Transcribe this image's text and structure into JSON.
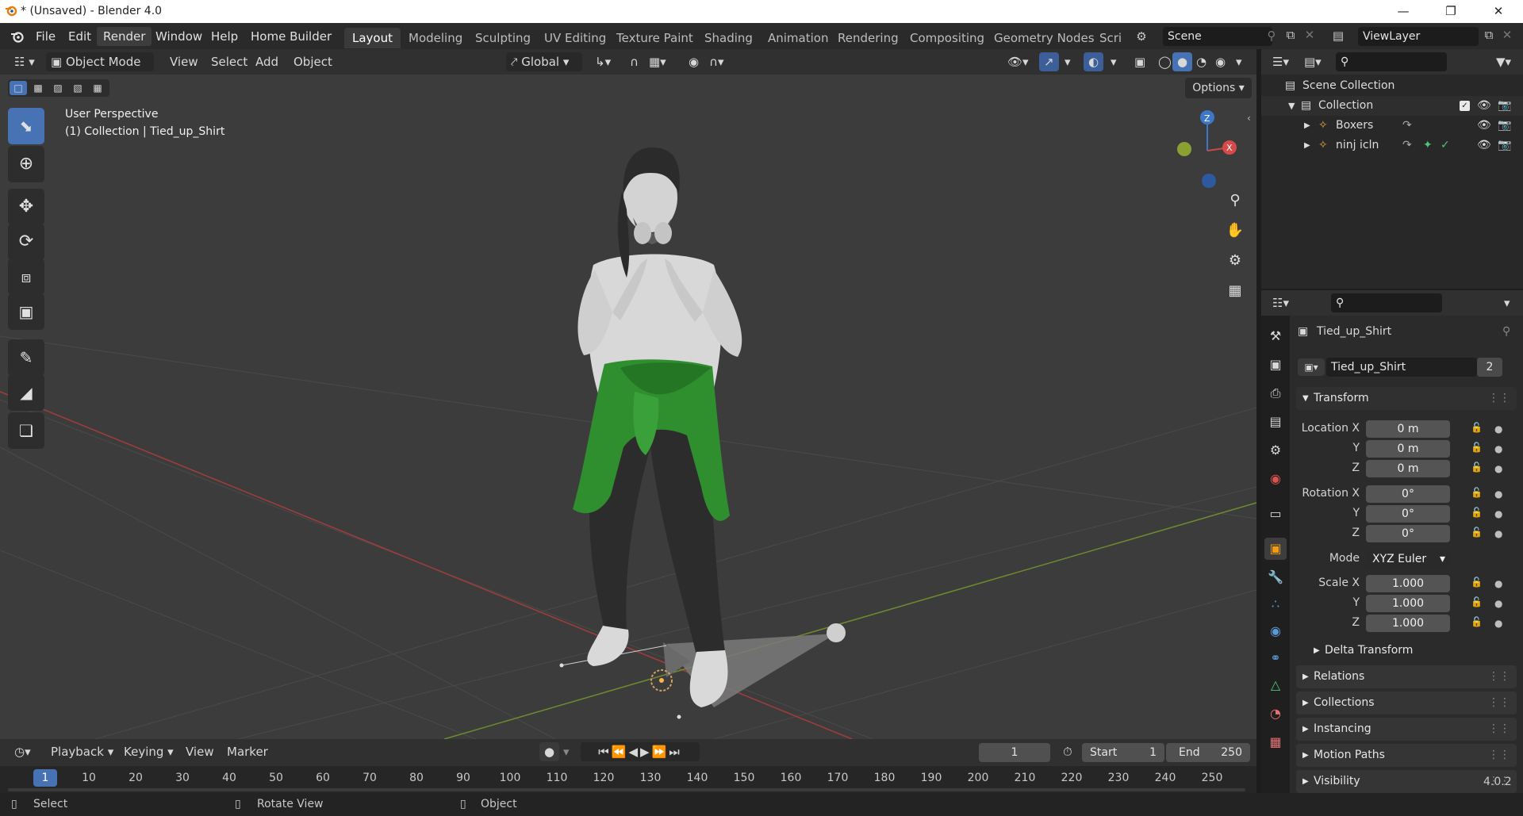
{
  "window": {
    "title": "* (Unsaved) - Blender 4.0",
    "controls": [
      "minimize-icon",
      "restore-icon",
      "close-icon"
    ]
  },
  "menubar": {
    "items": [
      "File",
      "Edit",
      "Render",
      "Window",
      "Help",
      "Home Builder"
    ],
    "active_item": "Render"
  },
  "workspaces": {
    "tabs": [
      "Layout",
      "Modeling",
      "Sculpting",
      "UV Editing",
      "Texture Paint",
      "Shading",
      "Animation",
      "Rendering",
      "Compositing",
      "Geometry Nodes",
      "Scri"
    ],
    "active": "Layout"
  },
  "scene_selector": {
    "value": "Scene"
  },
  "viewlayer_selector": {
    "value": "ViewLayer"
  },
  "viewport_header": {
    "mode": "Object Mode",
    "menus": [
      "View",
      "Select",
      "Add",
      "Object"
    ],
    "orientation": "Global",
    "options_label": "Options"
  },
  "viewport": {
    "perspective_label": "User Perspective",
    "context_label": "(1) Collection | Tied_up_Shirt",
    "gizmo_axes": {
      "z": "Z",
      "x": "X"
    },
    "colors": {
      "background": "#3c3c3c",
      "shirt": "#2f8f2f",
      "pants": "#2c2c2c",
      "skin": "#d8d8d8",
      "x_axis": "#a33c3c",
      "y_axis": "#6e8a2e"
    }
  },
  "toolbar": {
    "tools": [
      "select-box-icon",
      "cursor-icon",
      "move-icon",
      "rotate-icon",
      "scale-icon",
      "transform-icon",
      "annotate-icon",
      "measure-icon",
      "add-cube-icon"
    ]
  },
  "outliner": {
    "root": "Scene Collection",
    "collection": "Collection",
    "items": [
      {
        "name": "Boxers"
      },
      {
        "name": "ninj icln"
      }
    ]
  },
  "properties": {
    "object_name": "Tied_up_Shirt",
    "data_name": "Tied_up_Shirt",
    "users_count": "2",
    "transform_label": "Transform",
    "location": {
      "label": "Location X",
      "x": "0 m",
      "y": "0 m",
      "z": "0 m"
    },
    "rotation": {
      "label": "Rotation X",
      "x": "0°",
      "y": "0°",
      "z": "0°"
    },
    "mode": {
      "label": "Mode",
      "value": "XYZ Euler"
    },
    "scale": {
      "label": "Scale X",
      "x": "1.000",
      "y": "1.000",
      "z": "1.000"
    },
    "axis_labels": {
      "y": "Y",
      "z": "Z"
    },
    "panels": [
      "Delta Transform",
      "Relations",
      "Collections",
      "Instancing",
      "Motion Paths",
      "Visibility"
    ]
  },
  "timeline": {
    "menus": [
      "Playback",
      "Keying",
      "View",
      "Marker"
    ],
    "current_frame": "1",
    "start_label": "Start",
    "start": "1",
    "end_label": "End",
    "end": "250",
    "ticks": [
      "1",
      "10",
      "20",
      "30",
      "40",
      "50",
      "60",
      "70",
      "80",
      "90",
      "100",
      "110",
      "120",
      "130",
      "140",
      "150",
      "160",
      "170",
      "180",
      "190",
      "200",
      "210",
      "220",
      "230",
      "240",
      "250"
    ]
  },
  "statusbar": {
    "select": "Select",
    "rotate": "Rotate View",
    "object": "Object",
    "version": "4.0.2"
  }
}
